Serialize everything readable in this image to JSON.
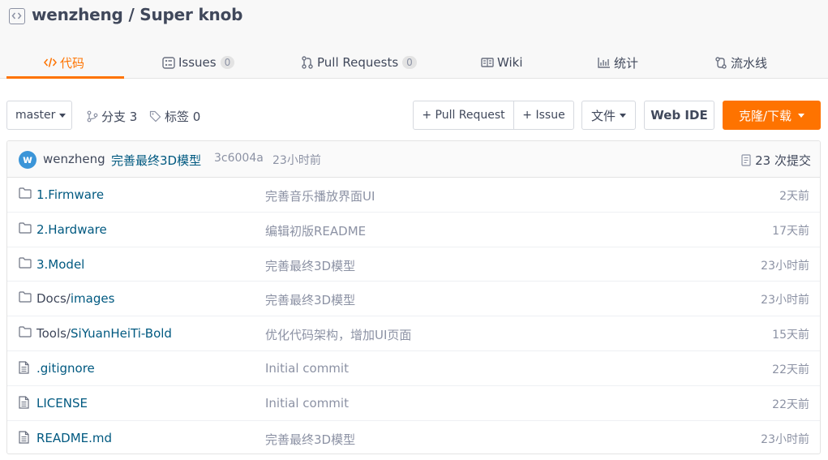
{
  "repo": {
    "title": "wenzheng / Super knob"
  },
  "tabs": [
    {
      "label": "代码",
      "icon": "code-icon",
      "active": true
    },
    {
      "label": "Issues",
      "icon": "issues-icon",
      "count": "0"
    },
    {
      "label": "Pull Requests",
      "icon": "pull-request-icon",
      "count": "0"
    },
    {
      "label": "Wiki",
      "icon": "wiki-icon"
    },
    {
      "label": "统计",
      "icon": "stats-icon"
    },
    {
      "label": "流水线",
      "icon": "pipeline-icon"
    }
  ],
  "toolbar": {
    "branch": "master",
    "branches_label": "分支 3",
    "tags_label": "标签 0",
    "pull_request_button": "+ Pull Request",
    "issue_button": "+ Issue",
    "file_button": "文件",
    "webide_button": "Web IDE",
    "clone_button": "克隆/下载"
  },
  "latest_commit": {
    "avatar_letter": "w",
    "author": "wenzheng",
    "message": "完善最终3D模型",
    "sha": "3c6004a",
    "time": "23小时前",
    "count_label": "23 次提交"
  },
  "files": [
    {
      "type": "folder",
      "prefix": "",
      "name": "1.Firmware",
      "message": "完善音乐播放界面UI",
      "time": "2天前"
    },
    {
      "type": "folder",
      "prefix": "",
      "name": "2.Hardware",
      "message": "编辑初版README",
      "time": "17天前"
    },
    {
      "type": "folder",
      "prefix": "",
      "name": "3.Model",
      "message": "完善最终3D模型",
      "time": "23小时前"
    },
    {
      "type": "folder",
      "prefix": "Docs/",
      "name": "images",
      "message": "完善最终3D模型",
      "time": "23小时前"
    },
    {
      "type": "folder",
      "prefix": "Tools/",
      "name": "SiYuanHeiTi-Bold",
      "message": "优化代码架构，增加UI页面",
      "time": "15天前"
    },
    {
      "type": "file",
      "prefix": "",
      "name": ".gitignore",
      "message": "Initial commit",
      "time": "22天前"
    },
    {
      "type": "file",
      "prefix": "",
      "name": "LICENSE",
      "message": "Initial commit",
      "time": "22天前"
    },
    {
      "type": "file",
      "prefix": "",
      "name": "README.md",
      "message": "完善最终3D模型",
      "time": "23小时前"
    }
  ],
  "colors": {
    "accent": "#fe7300",
    "link": "#005980",
    "muted": "#8c92a4"
  }
}
